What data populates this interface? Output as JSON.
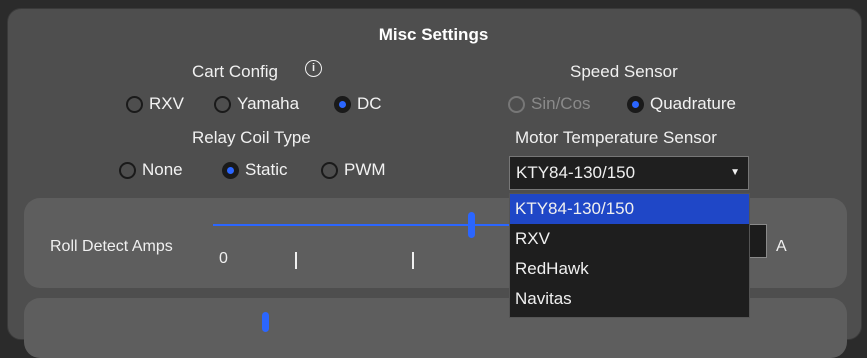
{
  "title": "Misc Settings",
  "cart_config": {
    "label": "Cart Config",
    "info_icon": "i",
    "options": [
      "RXV",
      "Yamaha",
      "DC"
    ],
    "selected": "DC"
  },
  "speed_sensor": {
    "label": "Speed Sensor",
    "options": [
      "Sin/Cos",
      "Quadrature"
    ],
    "selected": "Quadrature",
    "disabled": [
      "Sin/Cos"
    ]
  },
  "relay_coil": {
    "label": "Relay Coil Type",
    "options": [
      "None",
      "Static",
      "PWM"
    ],
    "selected": "Static"
  },
  "motor_temp": {
    "label": "Motor Temperature Sensor",
    "value": "KTY84-130/150",
    "options": [
      "KTY84-130/150",
      "RXV",
      "RedHawk",
      "Navitas"
    ]
  },
  "roll_detect": {
    "label": "Roll Detect Amps",
    "scale_start": "0",
    "unit": "A"
  },
  "colors": {
    "accent": "#2b66ff",
    "selected_option": "#1f47c7",
    "panel": "#4e4e4e",
    "background": "#2b2b2b"
  }
}
